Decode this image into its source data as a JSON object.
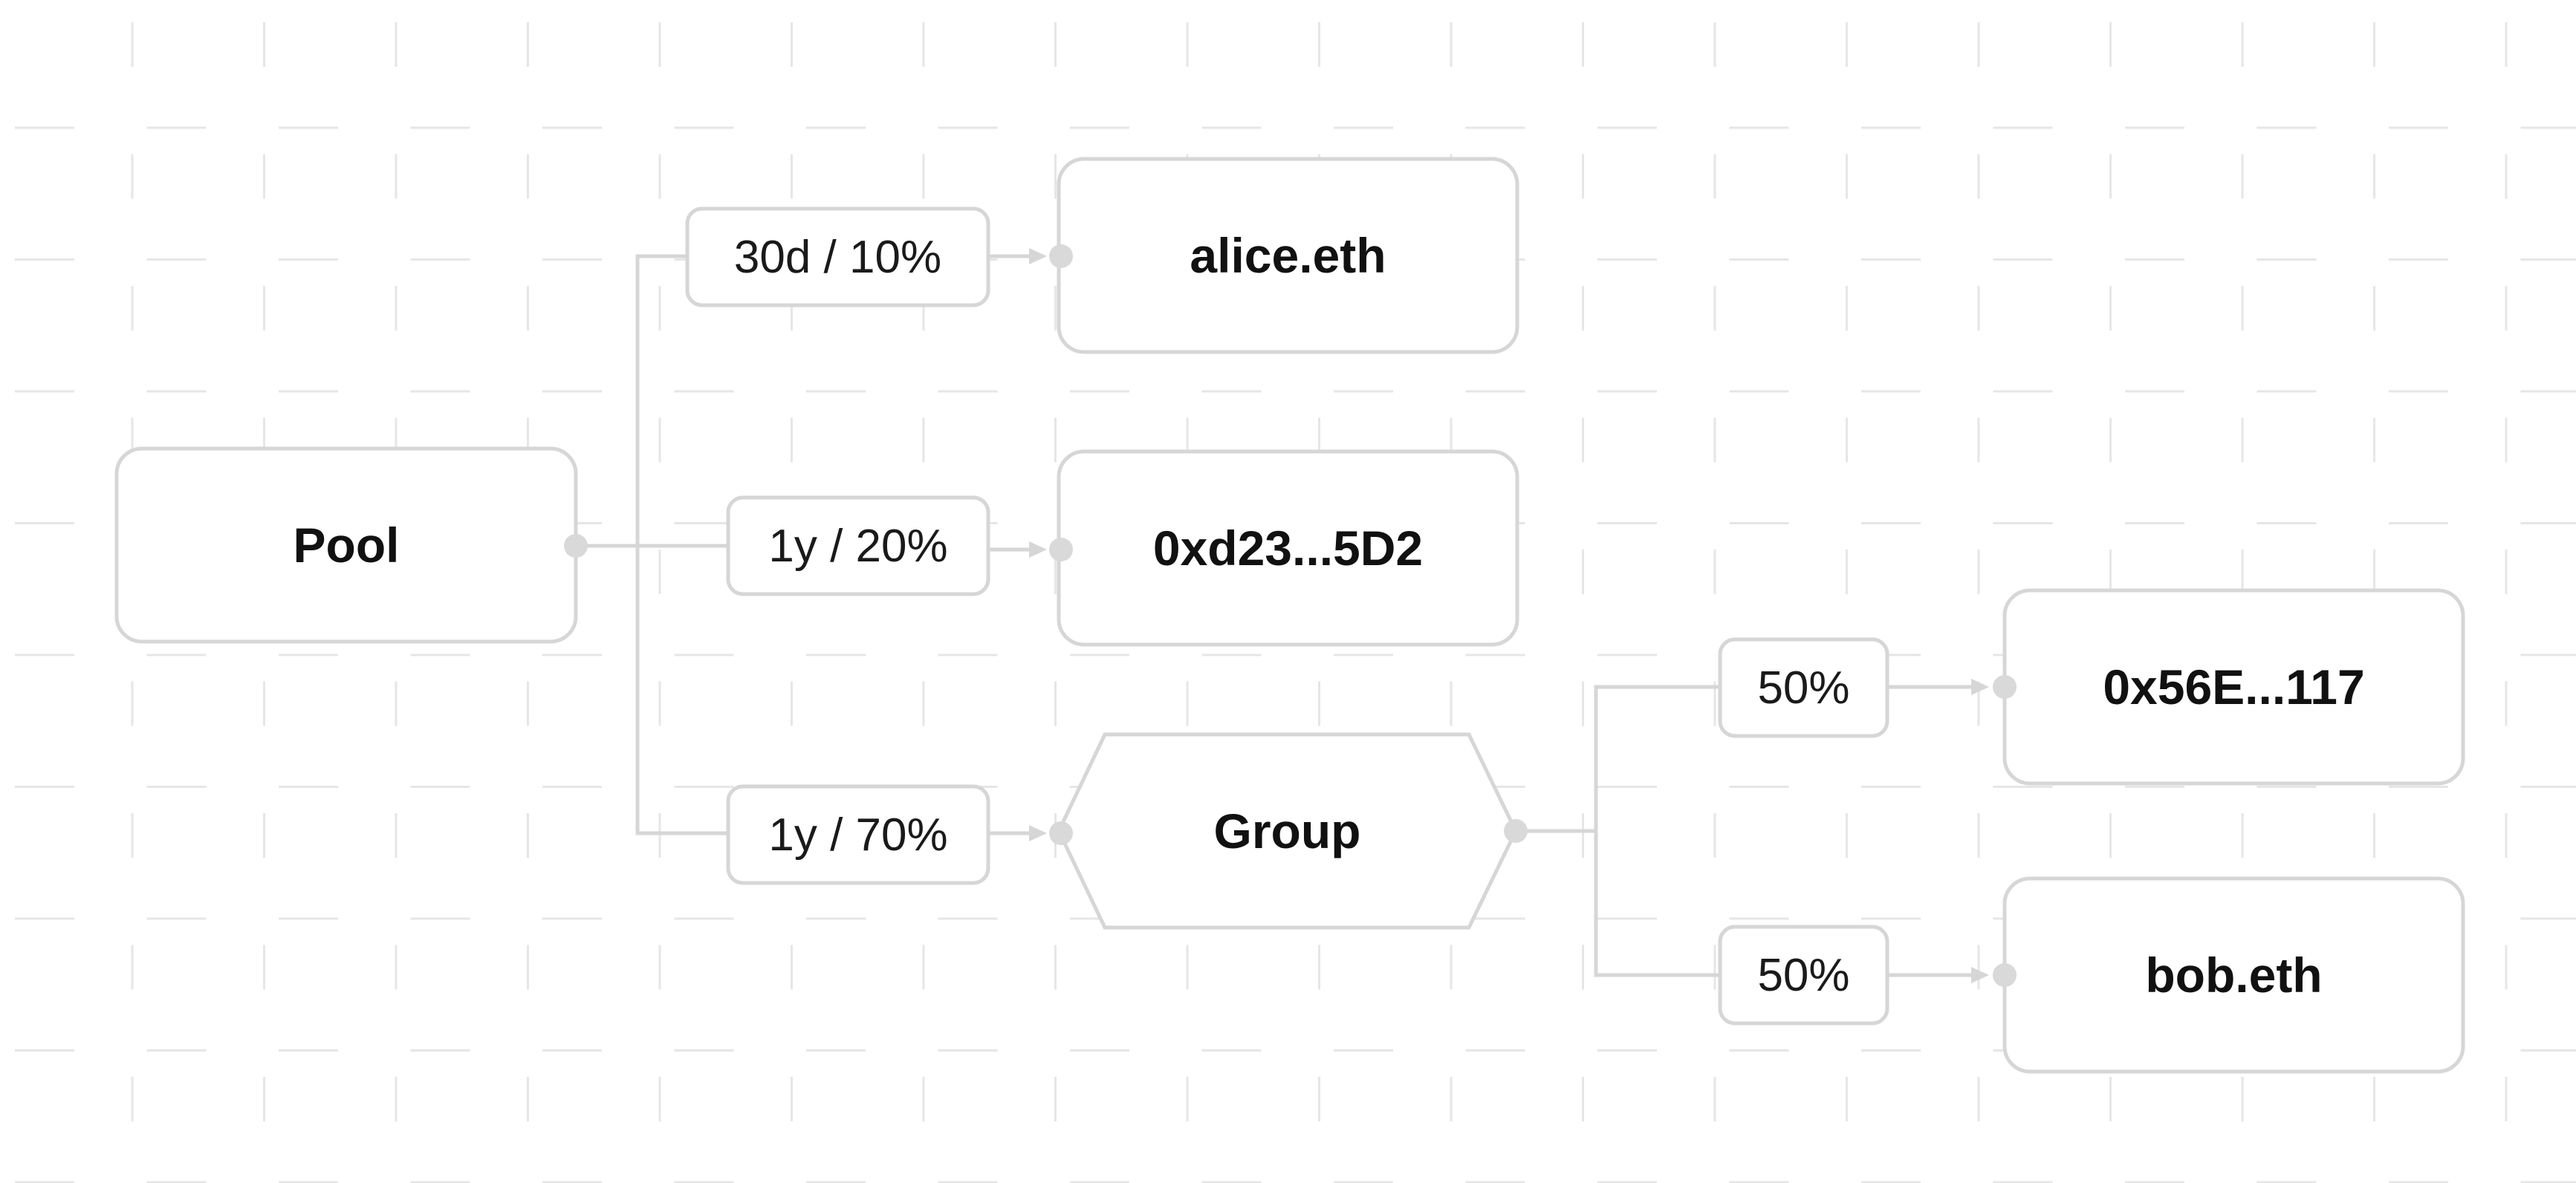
{
  "colors": {
    "background": "#ffffff",
    "grid": "#e6e6e6",
    "stroke": "#d6d6d6",
    "dot": "#d9d9d9",
    "text": "#111111"
  },
  "nodes": {
    "pool": {
      "label": "Pool",
      "shape": "rounded-rect"
    },
    "alice": {
      "label": "alice.eth",
      "shape": "rounded-rect"
    },
    "addr1": {
      "label": "0xd23...5D2",
      "shape": "rounded-rect"
    },
    "group": {
      "label": "Group",
      "shape": "hexagon"
    },
    "addr2": {
      "label": "0x56E...117",
      "shape": "rounded-rect"
    },
    "bob": {
      "label": "bob.eth",
      "shape": "rounded-rect"
    }
  },
  "edges": {
    "pool_alice": {
      "label": "30d / 10%"
    },
    "pool_addr1": {
      "label": "1y / 20%"
    },
    "pool_group": {
      "label": "1y / 70%"
    },
    "group_addr2": {
      "label": "50%"
    },
    "group_bob": {
      "label": "50%"
    }
  }
}
